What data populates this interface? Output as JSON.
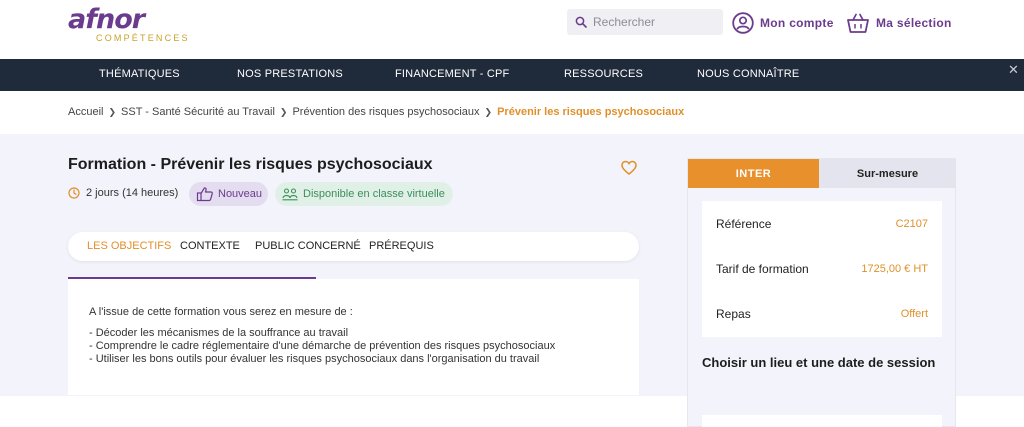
{
  "header": {
    "logo_main": "afnor",
    "logo_sub": "COMPÉTENCES",
    "search_placeholder": "Rechercher",
    "account_label": "Mon compte",
    "cart_label": "Ma sélection"
  },
  "nav": {
    "items": [
      "THÉMATIQUES",
      "NOS PRESTATIONS",
      "FINANCEMENT - CPF",
      "RESSOURCES",
      "NOUS CONNAÎTRE"
    ]
  },
  "breadcrumb": {
    "items": [
      "Accueil",
      "SST - Santé Sécurité au Travail",
      "Prévention des risques psychosociaux"
    ],
    "current": "Prévenir les risques psychosociaux"
  },
  "course": {
    "title": "Formation - Prévenir les risques psychosociaux",
    "duration": "2 jours (14 heures)",
    "badge_new": "Nouveau",
    "badge_virtual": "Disponible en classe virtuelle"
  },
  "tabs": [
    "LES OBJECTIFS",
    "CONTEXTE",
    "PUBLIC CONCERNÉ",
    "PRÉREQUIS"
  ],
  "objectives": {
    "intro": "A l'issue de cette formation vous serez en mesure de :",
    "items": [
      "- Décoder les mécanismes de la souffrance au travail",
      "- Comprendre le cadre réglementaire d'une démarche de prévention des risques psychosociaux",
      "- Utiliser les bons outils pour évaluer les risques psychosociaux dans l'organisation du travail"
    ]
  },
  "panel": {
    "tab_inter": "INTER",
    "tab_sur_mesure": "Sur-mesure",
    "reference_label": "Référence",
    "reference_value": "C2107",
    "tarif_label": "Tarif de formation",
    "tarif_value": "1725,00 € HT",
    "repas_label": "Repas",
    "repas_value": "Offert",
    "choose_title": "Choisir un lieu et une date de session"
  },
  "colors": {
    "brand_purple": "#6b3b8e",
    "accent_orange": "#e8902c",
    "nav_bg": "#1f2a3a"
  }
}
